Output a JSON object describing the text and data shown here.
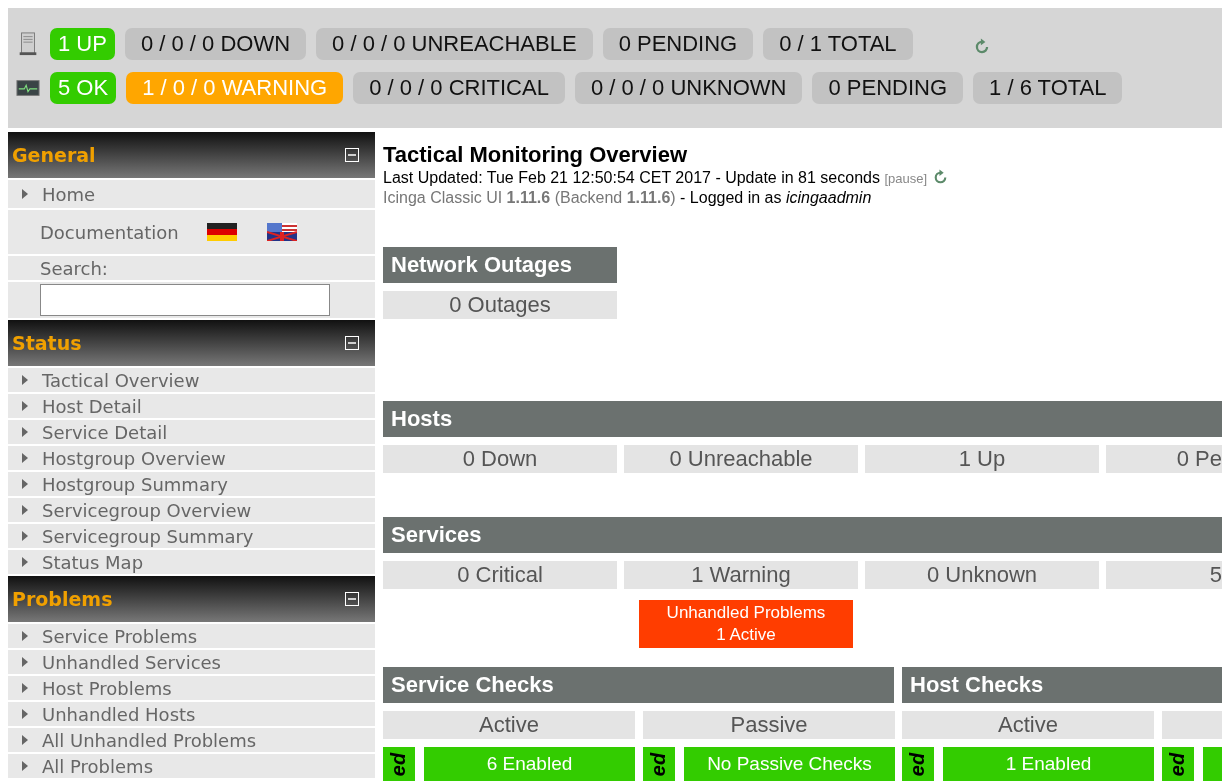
{
  "status_bar": {
    "rows": [
      {
        "kind": "host",
        "badges": [
          {
            "text": "1 UP",
            "color": "#33cc00"
          },
          {
            "text": "0 / 0 / 0 DOWN",
            "color": "#c2c2c2"
          },
          {
            "text": "0 / 0 / 0 UNREACHABLE",
            "color": "#c2c2c2"
          },
          {
            "text": "0 PENDING",
            "color": "#c2c2c2"
          },
          {
            "text": "0 / 1 TOTAL",
            "color": "#c2c2c2"
          }
        ],
        "refresh": true
      },
      {
        "kind": "service",
        "badges": [
          {
            "text": "5 OK",
            "color": "#33cc00"
          },
          {
            "text": "1 / 0 / 0 WARNING",
            "color": "#ffa600"
          },
          {
            "text": "0 / 0 / 0 CRITICAL",
            "color": "#c2c2c2"
          },
          {
            "text": "0 / 0 / 0 UNKNOWN",
            "color": "#c2c2c2"
          },
          {
            "text": "0 PENDING",
            "color": "#c2c2c2"
          },
          {
            "text": "1 / 6 TOTAL",
            "color": "#c2c2c2"
          }
        ],
        "refresh": false
      }
    ]
  },
  "sidebar": {
    "sections": [
      {
        "title": "General",
        "expanded": true,
        "items": [
          {
            "kind": "link",
            "label": "Home"
          },
          {
            "kind": "docs",
            "label": "Documentation"
          },
          {
            "kind": "search",
            "label": "Search:"
          }
        ]
      },
      {
        "title": "Status",
        "expanded": true,
        "items": [
          {
            "kind": "link",
            "label": "Tactical Overview"
          },
          {
            "kind": "link",
            "label": "Host Detail"
          },
          {
            "kind": "link",
            "label": "Service Detail"
          },
          {
            "kind": "link",
            "label": "Hostgroup Overview"
          },
          {
            "kind": "link",
            "label": "Hostgroup Summary"
          },
          {
            "kind": "link",
            "label": "Servicegroup Overview"
          },
          {
            "kind": "link",
            "label": "Servicegroup Summary"
          },
          {
            "kind": "link",
            "label": "Status Map"
          }
        ]
      },
      {
        "title": "Problems",
        "expanded": true,
        "items": [
          {
            "kind": "link",
            "label": "Service Problems"
          },
          {
            "kind": "link",
            "label": "Unhandled Services"
          },
          {
            "kind": "link",
            "label": "Host Problems"
          },
          {
            "kind": "link",
            "label": "Unhandled Hosts"
          },
          {
            "kind": "link",
            "label": "All Unhandled Problems"
          },
          {
            "kind": "link",
            "label": "All Problems"
          }
        ]
      }
    ]
  },
  "main": {
    "title": "Tactical Monitoring Overview",
    "last_updated": "Last Updated: Tue Feb 21 12:50:54 CET 2017 - Update in 81 seconds",
    "pause": "[pause]",
    "version": "Icinga Classic UI **1.11.6** (Backend **1.11.6**)",
    "logged_in": "- Logged in as *icingaadmin*",
    "network_outages": {
      "title": "Network Outages",
      "cells": [
        "0 Outages"
      ]
    },
    "hosts": {
      "title": "Hosts",
      "cells": [
        "0 Down",
        "0 Unreachable",
        "1 Up",
        "0 Pe"
      ]
    },
    "services": {
      "title": "Services",
      "cells": [
        "0 Critical",
        "1 Warning",
        "0 Unknown",
        "5"
      ],
      "alert": {
        "title": "Unhandled Problems",
        "detail": "1 Active"
      }
    },
    "checks": [
      {
        "title": "Service Checks",
        "columns": [
          "Active",
          "Passive"
        ],
        "truncated": false,
        "cells": [
          {
            "tag": "ed",
            "value": "6 Enabled"
          },
          {
            "tag": "ed",
            "value": "No Passive Checks"
          }
        ]
      },
      {
        "title": "Host Checks",
        "columns": [
          "Active"
        ],
        "truncated": true,
        "cells": [
          {
            "tag": "ed",
            "value": "1 Enabled"
          },
          {
            "tag": "ed"
          }
        ]
      }
    ]
  }
}
